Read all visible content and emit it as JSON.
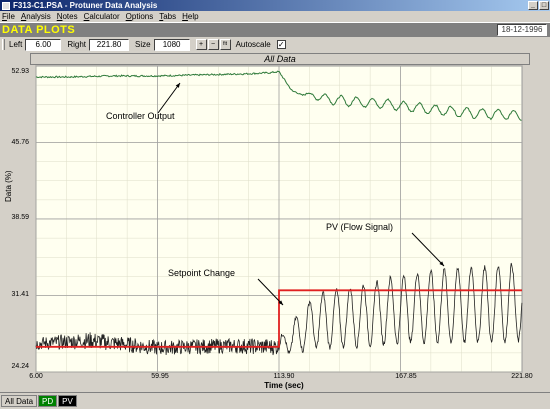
{
  "window": {
    "title": "F313-C1.PSA - Protuner Data Analysis"
  },
  "menu": [
    "File",
    "Analysis",
    "Notes",
    "Calculator",
    "Options",
    "Tabs",
    "Help"
  ],
  "header": {
    "title": "DATA PLOTS",
    "date": "18-12-1996"
  },
  "toolbar": {
    "left_label": "Left",
    "left_value": "6.00",
    "right_label": "Right",
    "right_value": "221.80",
    "size_label": "Size",
    "size_value": "1080",
    "autoscale_label": "Autoscale",
    "autoscale_checked": "✓",
    "zoom_in_icon": "+",
    "zoom_out_icon": "−",
    "fit_icon": "fit"
  },
  "plot": {
    "tab_title": "All Data",
    "ylabel": "Data (%)",
    "xlabel": "Time (sec)",
    "yticks": [
      "52.93",
      "45.76",
      "38.59",
      "31.41",
      "24.24"
    ],
    "xticks": [
      "6.00",
      "59.95",
      "113.90",
      "167.85",
      "221.80"
    ],
    "annotations": {
      "controller_output": "Controller Output",
      "pv": "PV (Flow Signal)",
      "setpoint_change": "Setpoint Change"
    }
  },
  "chart_data": {
    "type": "line",
    "xlabel": "Time (sec)",
    "ylabel": "Data (%)",
    "title": "All Data",
    "xlim": [
      6.0,
      221.8
    ],
    "ylim": [
      24.24,
      52.93
    ],
    "grid": true,
    "series": [
      {
        "name": "Controller Output",
        "color": "#2f7a3a",
        "x": [
          6,
          20,
          40,
          60,
          80,
          100,
          110,
          113.9,
          120,
          140,
          160,
          180,
          200,
          221.8
        ],
        "values": [
          51.9,
          51.9,
          52.0,
          52.0,
          52.1,
          52.2,
          52.3,
          52.4,
          50.5,
          49.7,
          49.4,
          48.9,
          48.5,
          48.3
        ]
      },
      {
        "name": "Setpoint",
        "color": "#e02020",
        "x": [
          6,
          113.9,
          113.9,
          221.8
        ],
        "values": [
          26.6,
          26.6,
          31.9,
          31.9
        ]
      },
      {
        "name": "PV (Flow Signal)",
        "color": "#202020",
        "x": [
          6,
          30,
          60,
          90,
          113.9,
          130,
          150,
          170,
          190,
          210,
          221.8
        ],
        "values": [
          26.9,
          27.2,
          26.5,
          26.7,
          26.6,
          29.0,
          29.5,
          30.2,
          30.5,
          30.6,
          30.8
        ],
        "oscillation_amplitude": [
          0.6,
          0.8,
          0.7,
          0.7,
          0.8,
          2.5,
          2.8,
          3.2,
          3.4,
          3.6,
          3.6
        ]
      }
    ]
  },
  "bottom_tabs": [
    "All Data",
    "PD",
    "PV"
  ],
  "colors": {
    "grid": "#a0a0a0",
    "plot_bg": "#fffff0",
    "header_text": "#ffff00"
  }
}
